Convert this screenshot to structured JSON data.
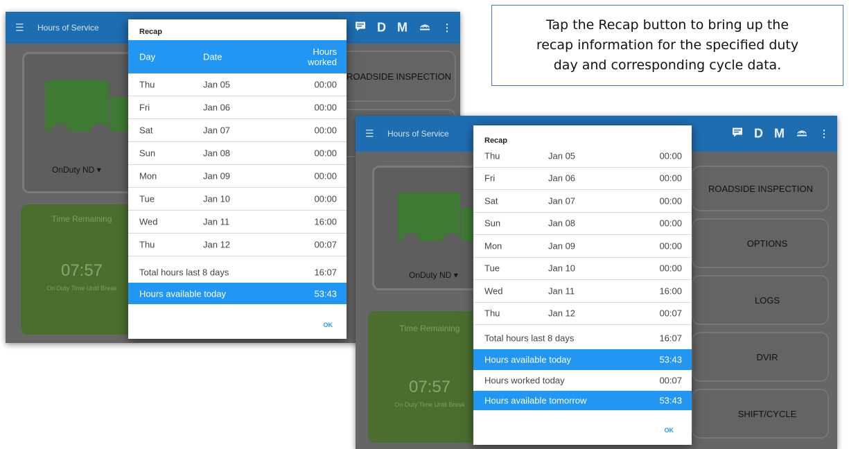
{
  "callout": {
    "line1": "Tap the Recap button to bring up the",
    "line2": "recap information for the specified duty",
    "line3": "day and corresponding cycle data."
  },
  "app": {
    "title": "Hours of Service",
    "menu_icon": "☰",
    "top_icons": {
      "message": "message-icon",
      "d_label": "D",
      "m_label": "M",
      "signal": "eld-signal-icon"
    },
    "duty_status": "OnDuty ND",
    "time_remaining_label": "Time Remaining",
    "time_remaining_value": "07:57",
    "time_remaining_sub": "On Duty Time Until Break",
    "buttons": [
      "ROADSIDE INSPECTION",
      "OPTIONS",
      "LOGS",
      "DVIR",
      "SHIFT/CYCLE"
    ],
    "colors": {
      "appbar": "#1e6db0",
      "highlight": "#2196f3",
      "truck": "#3f7a34"
    }
  },
  "recap_left": {
    "title": "Recap",
    "headers": {
      "day": "Day",
      "date": "Date",
      "hours": "Hours worked"
    },
    "rows": [
      {
        "day": "Thu",
        "date": "Jan 05",
        "hours": "00:00"
      },
      {
        "day": "Fri",
        "date": "Jan 06",
        "hours": "00:00"
      },
      {
        "day": "Sat",
        "date": "Jan 07",
        "hours": "00:00"
      },
      {
        "day": "Sun",
        "date": "Jan 08",
        "hours": "00:00"
      },
      {
        "day": "Mon",
        "date": "Jan 09",
        "hours": "00:00"
      },
      {
        "day": "Tue",
        "date": "Jan 10",
        "hours": "00:00"
      },
      {
        "day": "Wed",
        "date": "Jan 11",
        "hours": "16:00"
      },
      {
        "day": "Thu",
        "date": "Jan 12",
        "hours": "00:07"
      }
    ],
    "total_label": "Total hours last 8 days",
    "total_value": "16:07",
    "available_today_label": "Hours available today",
    "available_today_value": "53:43",
    "ok_label": "OK"
  },
  "recap_right": {
    "title": "Recap",
    "rows": [
      {
        "day": "Thu",
        "date": "Jan 05",
        "hours": "00:00"
      },
      {
        "day": "Fri",
        "date": "Jan 06",
        "hours": "00:00"
      },
      {
        "day": "Sat",
        "date": "Jan 07",
        "hours": "00:00"
      },
      {
        "day": "Sun",
        "date": "Jan 08",
        "hours": "00:00"
      },
      {
        "day": "Mon",
        "date": "Jan 09",
        "hours": "00:00"
      },
      {
        "day": "Tue",
        "date": "Jan 10",
        "hours": "00:00"
      },
      {
        "day": "Wed",
        "date": "Jan 11",
        "hours": "16:00"
      },
      {
        "day": "Thu",
        "date": "Jan 12",
        "hours": "00:07"
      }
    ],
    "total_label": "Total hours last 8 days",
    "total_value": "16:07",
    "available_today_label": "Hours available today",
    "available_today_value": "53:43",
    "worked_today_label": "Hours worked today",
    "worked_today_value": "00:07",
    "available_tomorrow_label": "Hours available tomorrow",
    "available_tomorrow_value": "53:43",
    "ok_label": "OK"
  }
}
